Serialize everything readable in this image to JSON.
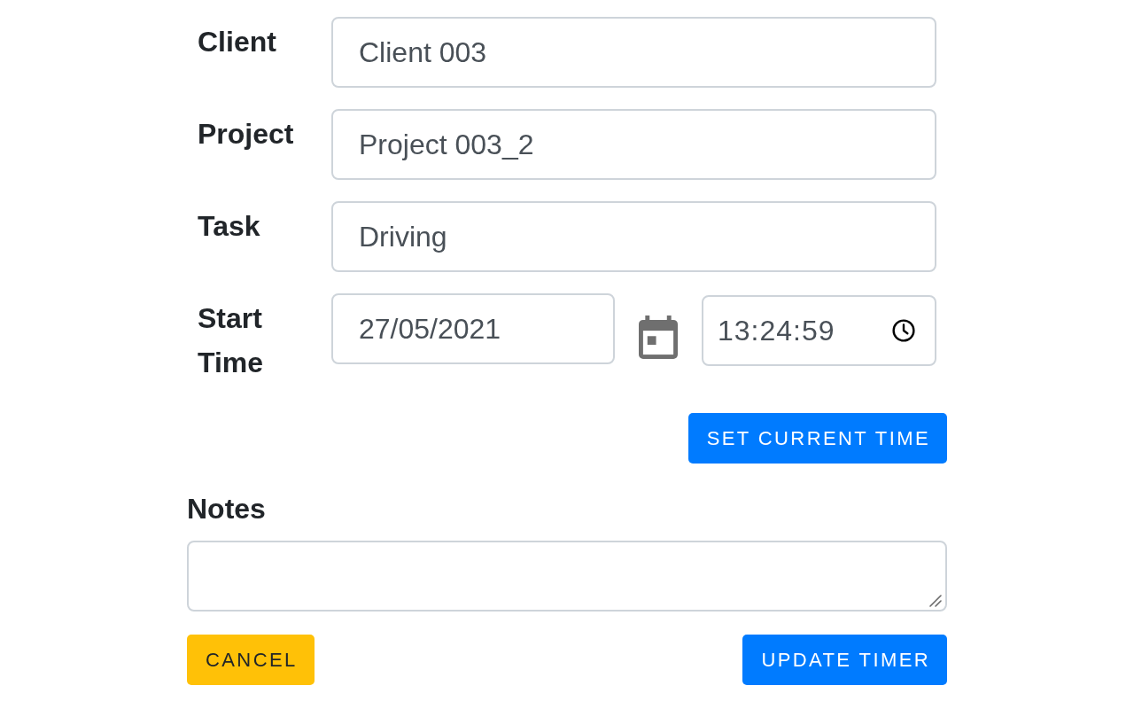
{
  "fields": [
    {
      "label": "Client",
      "value": "Client 003"
    },
    {
      "label": "Project",
      "value": "Project 003_2"
    },
    {
      "label": "Task",
      "value": "Driving"
    }
  ],
  "start_time": {
    "label": "Start Time",
    "date": "27/05/2021",
    "time": "13:24:59"
  },
  "set_current_time_button": {
    "label": "SET CURRENT TIME",
    "kind": "primary"
  },
  "notes": {
    "label": "Notes"
  },
  "buttons": [
    {
      "label": "CANCEL",
      "kind": "warning"
    },
    {
      "label": "UPDATE TIMER",
      "kind": "primary"
    }
  ]
}
